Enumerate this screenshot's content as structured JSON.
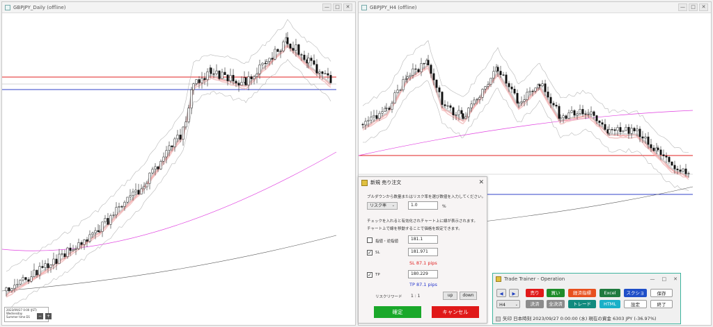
{
  "left_window": {
    "title": "GBPJPY_Daily (offline)",
    "info_lines": [
      "2023/09/27 0:00 (JST)",
      "Wednesday",
      "Summer time  D1"
    ]
  },
  "right_window": {
    "title": "GBPJPY_H4 (offline)"
  },
  "window_buttons": {
    "minimize": "—",
    "maximize": "□",
    "close": "✕"
  },
  "order_dialog": {
    "title": "新規 売り注文",
    "close": "✕",
    "instruction": "ブルダウンから数量またはリスク率を選び数値を入力してください。",
    "risk_select": "リスク率",
    "risk_value": "1.0",
    "risk_unit": "%",
    "note1": "チェックを入れると有効化されチャート上に線が表示されます。",
    "note2": "チャート上で線を移動することで価格を設定できます。",
    "limit_label": "指値・逆指値",
    "limit_value": "181.1",
    "limit_checked": false,
    "sl_label": "SL",
    "sl_value": "181.971",
    "sl_checked": true,
    "sl_pips": "SL 87.1 pips",
    "tp_label": "TP",
    "tp_value": "180.229",
    "tp_checked": true,
    "tp_pips": "TP 87.1 pips",
    "risk_reward_label": "リスクリワード",
    "risk_reward_value": "1 : 1",
    "up_label": "up",
    "down_label": "down",
    "confirm_label": "確定",
    "cancel_label": "キャンセル"
  },
  "operation_panel": {
    "title": "Trade Trainer - Operation",
    "timeframe": "H4",
    "buttons_row1": [
      "売り",
      "買い",
      "経済指標",
      "Excel",
      "スクショ",
      "保存"
    ],
    "buttons_row2": [
      "決済",
      "全決済",
      "トレード",
      "HTML",
      "設定",
      "終了"
    ],
    "status": "矢印  日本時刻 2023/09/27 0:00:00 (水)   現在の資金 6303 JPY (-36.97%)"
  },
  "colors": {
    "sell": "#e01919",
    "buy": "#1e8c2a",
    "econ": "#e8501e",
    "excel": "#1f7a3e",
    "screenshot": "#1f4fc8",
    "trade": "#118a7e",
    "html": "#1ab0c8",
    "settle": "#8c8c8c",
    "confirm": "#1aa82a",
    "cancel": "#e01919",
    "sl_text": "#e02020",
    "tp_text": "#2233cc"
  }
}
